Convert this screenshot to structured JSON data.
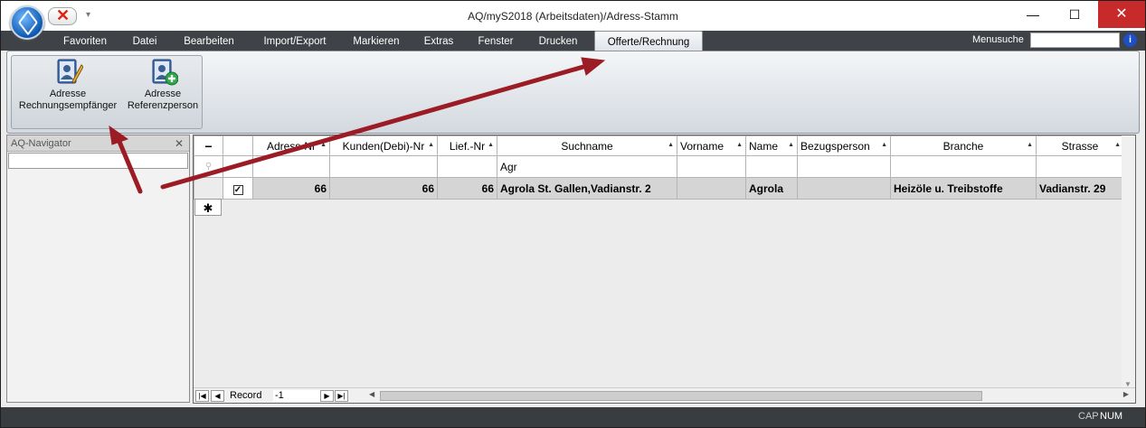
{
  "window": {
    "title": "AQ/myS2018 (Arbeitsdaten)/Adress-Stamm"
  },
  "menu": {
    "items": [
      "Favoriten",
      "Datei",
      "Bearbeiten",
      "Import/Export",
      "Markieren",
      "Extras",
      "Fenster",
      "Drucken",
      "Offerte/Rechnung"
    ],
    "active": "Offerte/Rechnung",
    "search_label": "Menusuche"
  },
  "ribbon": {
    "buttons": [
      {
        "line1": "Adresse",
        "line2": "Rechnungsempfänger"
      },
      {
        "line1": "Adresse",
        "line2": "Referenzperson"
      }
    ]
  },
  "navigator": {
    "title": "AQ-Navigator"
  },
  "grid": {
    "columns": [
      "Adress-Nr",
      "Kunden(Debi)-Nr",
      "Lief.-Nr",
      "Suchname",
      "Vorname",
      "Name",
      "Bezugsperson",
      "Branche",
      "Strasse"
    ],
    "filter": {
      "suchname": "Agr"
    },
    "row": {
      "adress_nr": "66",
      "kunden_nr": "66",
      "lief_nr": "66",
      "suchname": "Agrola St. Gallen,Vadianstr. 2",
      "vorname": "",
      "name": "Agrola",
      "bezugsperson": "",
      "branche": "Heizöle u. Treibstoffe",
      "strasse": "Vadianstr. 29"
    },
    "record_label": "Record",
    "record_value": "-1"
  },
  "status": {
    "cap": "CAP",
    "num": "NUM"
  },
  "colors": {
    "annotation_arrow": "#9b1c24",
    "menubar": "#3f4347",
    "close": "#c72a2a"
  }
}
